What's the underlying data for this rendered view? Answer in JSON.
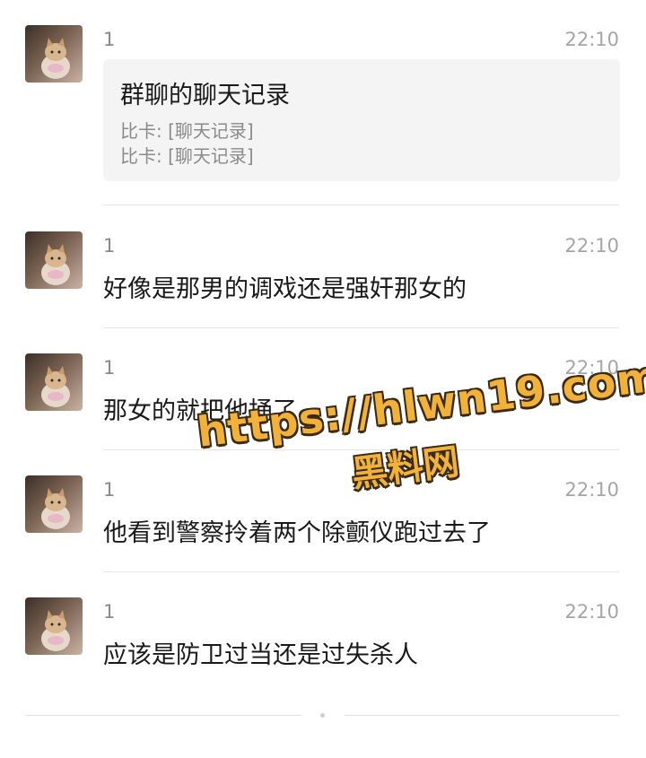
{
  "messages": [
    {
      "sender": "1",
      "time": "22:10",
      "card": {
        "title": "群聊的聊天记录",
        "lines": [
          "比卡: [聊天记录]",
          "比卡: [聊天记录]"
        ]
      }
    },
    {
      "sender": "1",
      "time": "22:10",
      "text": "好像是那男的调戏还是强奸那女的"
    },
    {
      "sender": "1",
      "time": "22:10",
      "text": "那女的就把他捅了"
    },
    {
      "sender": "1",
      "time": "22:10",
      "text": "他看到警察拎着两个除颤仪跑过去了"
    },
    {
      "sender": "1",
      "time": "22:10",
      "text": "应该是防卫过当还是过失杀人"
    }
  ],
  "watermark": {
    "url": "https://hlwn19.com",
    "name": "黑料网"
  },
  "colors": {
    "bubble_bg": "#f4f4f4",
    "secondary_text": "#8a8a8a",
    "primary_text": "#191919",
    "watermark": "#f2b23a"
  }
}
